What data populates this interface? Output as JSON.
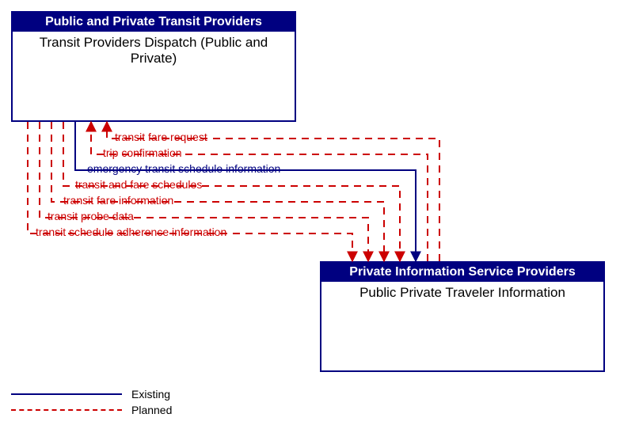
{
  "boxes": {
    "top": {
      "header": "Public and Private Transit Providers",
      "body": "Transit Providers Dispatch (Public and Private)"
    },
    "bottom": {
      "header": "Private Information Service Providers",
      "body": "Public Private Traveler Information"
    }
  },
  "flows": [
    {
      "id": "f1",
      "label": "transit fare request",
      "status": "planned",
      "direction": "to_top"
    },
    {
      "id": "f2",
      "label": "trip confirmation",
      "status": "planned",
      "direction": "to_top"
    },
    {
      "id": "f3",
      "label": "emergency transit schedule information",
      "status": "existing",
      "direction": "to_bottom"
    },
    {
      "id": "f4",
      "label": "transit and fare schedules",
      "status": "planned",
      "direction": "to_bottom"
    },
    {
      "id": "f5",
      "label": "transit fare information",
      "status": "planned",
      "direction": "to_bottom"
    },
    {
      "id": "f6",
      "label": "transit probe data",
      "status": "planned",
      "direction": "to_bottom"
    },
    {
      "id": "f7",
      "label": "transit schedule adherence information",
      "status": "planned",
      "direction": "to_bottom"
    }
  ],
  "legend": {
    "existing": "Existing",
    "planned": "Planned"
  },
  "colors": {
    "existing": "#000080",
    "planned": "#cc0000"
  }
}
